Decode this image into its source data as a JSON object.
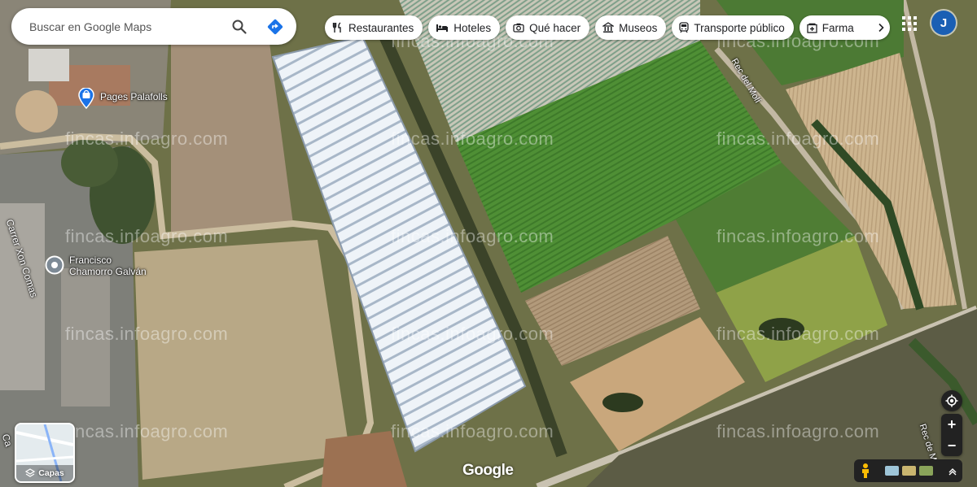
{
  "search": {
    "placeholder": "Buscar en Google Maps"
  },
  "chips": [
    {
      "label": "Restaurantes",
      "icon": "restaurant-icon"
    },
    {
      "label": "Hoteles",
      "icon": "hotel-icon"
    },
    {
      "label": "Qué hacer",
      "icon": "camera-icon"
    },
    {
      "label": "Museos",
      "icon": "museum-icon"
    },
    {
      "label": "Transporte público",
      "icon": "train-icon"
    },
    {
      "label": "Farma",
      "icon": "pharmacy-icon"
    }
  ],
  "account": {
    "initial": "J",
    "color": "#1a5fb4"
  },
  "places": [
    {
      "name": "Pages Palafolls",
      "icon": "shopping-bag-pin-icon",
      "color": "#1a73e8"
    },
    {
      "name_line1": "Francisco",
      "name_line2": "Chamorro Galván",
      "icon": "place-pin-icon",
      "color": "#7d8a96"
    }
  ],
  "roads": [
    {
      "name": "Carrer Xon Comas"
    },
    {
      "name": "Rec del Molí"
    },
    {
      "name": "Rec de M"
    },
    {
      "name": "Ca"
    }
  ],
  "watermark": "fincas.infoagro.com",
  "layers": {
    "label": "Capas"
  },
  "branding": {
    "logo": "Google"
  },
  "controls": {
    "zoom_in": "+",
    "zoom_out": "−"
  }
}
